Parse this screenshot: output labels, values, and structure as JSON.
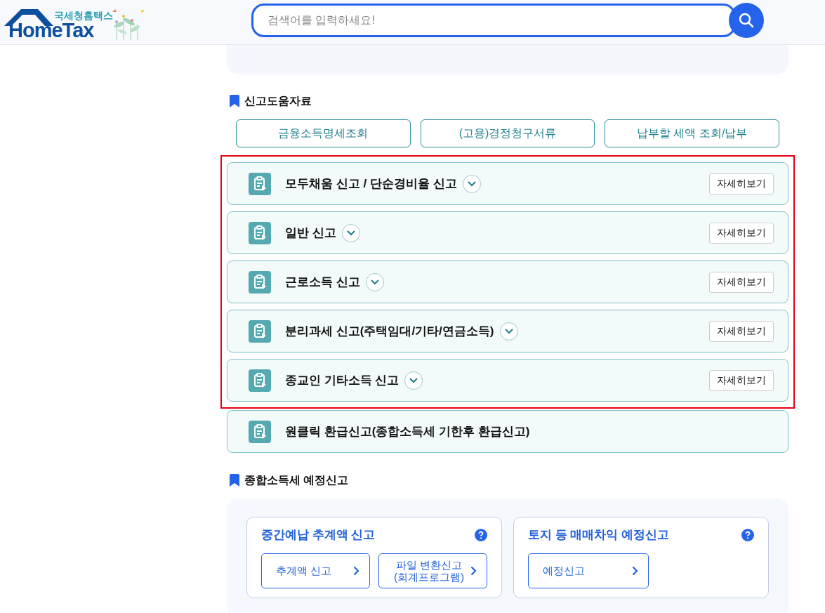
{
  "header": {
    "logo_caption": "국세청홈택스",
    "logo_text": "HomeTax",
    "search": {
      "placeholder": "검색어를 입력하세요!"
    }
  },
  "help_section": {
    "title": "신고도움자료",
    "buttons": [
      "금융소득명세조회",
      "(고용)경정청구서류",
      "납부할 세액 조회/납부"
    ]
  },
  "report_items": [
    {
      "kind": "expandable",
      "title": "모두채움 신고 / 단순경비율 신고",
      "expanded": false,
      "highlighted": true,
      "detail_button": "자세히보기"
    },
    {
      "kind": "expandable",
      "title": "일반 신고",
      "expanded": false,
      "highlighted": true,
      "detail_button": "자세히보기"
    },
    {
      "kind": "expandable",
      "title": "근로소득 신고",
      "expanded": false,
      "highlighted": true,
      "detail_button": "자세히보기"
    },
    {
      "kind": "expandable",
      "title": "분리과세 신고(주택임대/기타/연금소득)",
      "expanded": false,
      "highlighted": true,
      "detail_button": "자세히보기"
    },
    {
      "kind": "expandable",
      "title": "종교인 기타소득 신고",
      "expanded": false,
      "highlighted": true,
      "detail_button": "자세히보기"
    },
    {
      "kind": "plain",
      "title": "원클릭 환급신고(종합소득세 기한후 환급신고)",
      "highlighted": false
    }
  ],
  "interim_section": {
    "title": "종합소득세 예정신고",
    "cards": [
      {
        "title": "중간예납 추계액 신고",
        "buttons": [
          {
            "lines": [
              "추계액 신고"
            ]
          },
          {
            "lines": [
              "파일 변환신고",
              "(회계프로그램)"
            ]
          }
        ]
      },
      {
        "title": "토지 등 매매차익 예정신고",
        "buttons": [
          {
            "lines": [
              "예정신고"
            ]
          }
        ]
      }
    ]
  }
}
